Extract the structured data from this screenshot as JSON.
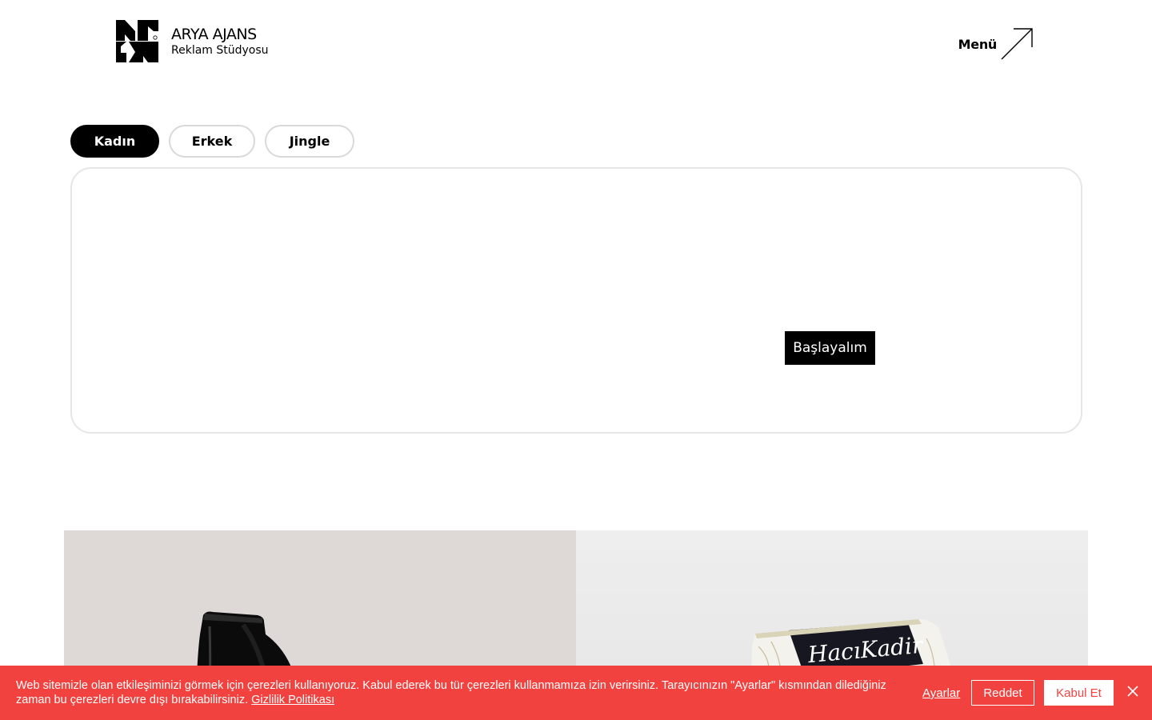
{
  "brand": {
    "name": "ARYA AJANS",
    "subtitle": "Reklam Stüdyosu",
    "logo_icon": "arya-logo-mark"
  },
  "header": {
    "menu_label": "Menü",
    "menu_icon": "arrow-up-right-icon"
  },
  "tabs": [
    {
      "label": "Kadın",
      "active": true
    },
    {
      "label": "Erkek",
      "active": false
    },
    {
      "label": "Jingle",
      "active": false
    }
  ],
  "player": {
    "start_label": "Başlayalım"
  },
  "gallery": {
    "items": [
      {
        "product_label": ""
      },
      {
        "product_label": "HacıKadir"
      }
    ]
  },
  "cookie_banner": {
    "text": "Web sitemizle olan etkileşiminizi görmek için çerezleri kullanıyoruz. Kabul ederek bu tür çerezleri kullanmamıza izin verirsiniz. Tarayıcınızın \"Ayarlar\" kısmından dilediğiniz zaman bu çerezleri devre dışı bırakabilirsiniz.",
    "privacy_link": "Gizlilik Politikası",
    "settings_label": "Ayarlar",
    "reject_label": "Reddet",
    "accept_label": "Kabul Et",
    "background_color": "#f2423f"
  }
}
